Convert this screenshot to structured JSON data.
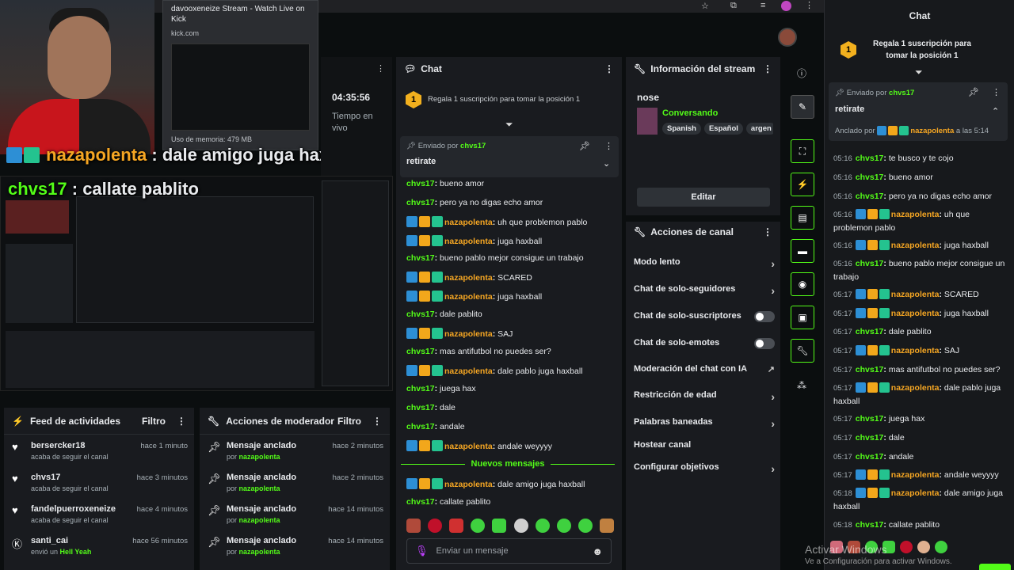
{
  "tab_preview": {
    "title": "davooxeneize Stream - Watch Live on Kick",
    "url": "kick.com",
    "memory": "Uso de memoria: 479 MB"
  },
  "overlay_chat": [
    {
      "user": "nazapolenta",
      "sep": " : ",
      "text": "dale amigo juga haxball"
    },
    {
      "user": "chvs17",
      "sep": " : ",
      "text": "callate pablito"
    }
  ],
  "stats": {
    "time": "04:35:56",
    "label": "Tiempo en vivo"
  },
  "feed": {
    "title": "Feed de actividades",
    "filter": "Filtro",
    "items": [
      {
        "name": "bersercker18",
        "sub": "acaba de seguir el canal",
        "time": "hace 1 minuto"
      },
      {
        "name": "chvs17",
        "sub": "acaba de seguir el canal",
        "time": "hace 3 minutos"
      },
      {
        "name": "fandelpuerroxeneize",
        "sub": "acaba de seguir el canal",
        "time": "hace 4 minutos"
      },
      {
        "name": "santi_cai",
        "sub": "envió un",
        "sub2": "Hell Yeah",
        "time": "hace 56 minutos"
      }
    ]
  },
  "mod_actions": {
    "title": "Acciones de moderador",
    "filter": "Filtro",
    "items": [
      {
        "name": "Mensaje anclado",
        "by": "por",
        "user": "nazapolenta",
        "time": "hace 2 minutos"
      },
      {
        "name": "Mensaje anclado",
        "by": "por",
        "user": "nazapolenta",
        "time": "hace 2 minutos"
      },
      {
        "name": "Mensaje anclado",
        "by": "por",
        "user": "nazapolenta",
        "time": "hace 14 minutos"
      },
      {
        "name": "Mensaje anclado",
        "by": "por",
        "user": "nazapolenta",
        "time": "hace 14 minutos"
      }
    ]
  },
  "chat": {
    "title": "Chat",
    "gift": "Regala 1 suscripción para tomar la posición 1",
    "pinned": {
      "label": "Enviado por",
      "user": "chvs17",
      "text": "retirate"
    },
    "messages": [
      {
        "user": "chvs17",
        "badges": false,
        "text": "bueno amor"
      },
      {
        "user": "chvs17",
        "badges": false,
        "text": "pero ya no digas echo amor"
      },
      {
        "user": "nazapolenta",
        "badges": true,
        "text": "uh que problemon pablo"
      },
      {
        "user": "nazapolenta",
        "badges": true,
        "text": "juga haxball"
      },
      {
        "user": "chvs17",
        "badges": false,
        "text": "bueno pablo mejor consigue un trabajo"
      },
      {
        "user": "nazapolenta",
        "badges": true,
        "text": "SCARED"
      },
      {
        "user": "nazapolenta",
        "badges": true,
        "text": "juga haxball"
      },
      {
        "user": "chvs17",
        "badges": false,
        "text": "dale pablito"
      },
      {
        "user": "nazapolenta",
        "badges": true,
        "text": "SAJ"
      },
      {
        "user": "chvs17",
        "badges": false,
        "text": "mas antifutbol no puedes ser?"
      },
      {
        "user": "nazapolenta",
        "badges": true,
        "text": "dale pablo juga haxball"
      },
      {
        "user": "chvs17",
        "badges": false,
        "text": "juega hax"
      },
      {
        "user": "chvs17",
        "badges": false,
        "text": "dale"
      },
      {
        "user": "chvs17",
        "badges": false,
        "text": "andale"
      },
      {
        "user": "nazapolenta",
        "badges": true,
        "text": "andale weyyyy"
      }
    ],
    "new_label": "Nuevos mensajes",
    "new_messages": [
      {
        "user": "nazapolenta",
        "badges": true,
        "text": "dale amigo juga haxball"
      },
      {
        "user": "chvs17",
        "badges": false,
        "text": "callate pablito"
      }
    ],
    "input_placeholder": "Enviar un mensaje"
  },
  "info": {
    "title": "Información del stream",
    "stream_title": "nose",
    "category": "Conversando",
    "tags": [
      "Spanish",
      "Español",
      "argen"
    ],
    "edit": "Editar"
  },
  "channel_actions": {
    "title": "Acciones de canal",
    "items": [
      "Modo lento",
      "Chat de solo-seguidores",
      "Chat de solo-suscriptores",
      "Chat de solo-emotes",
      "Moderación del chat con IA",
      "Restricción de edad",
      "Palabras baneadas",
      "Hostear canal",
      "Configurar objetivos"
    ]
  },
  "rchat": {
    "title": "Chat",
    "gift": "Regala 1 suscripción para tomar la posición 1",
    "pinned": {
      "label": "Enviado por",
      "user": "chvs17",
      "text": "retirate",
      "anchored": "Anclado por",
      "anchor_user": "nazapolenta",
      "anchor_time": "a las 5:14"
    },
    "messages": [
      {
        "ts": "05:16",
        "user": "chvs17",
        "badges": false,
        "text": "te busco y te cojo"
      },
      {
        "ts": "05:16",
        "user": "chvs17",
        "badges": false,
        "text": "bueno amor"
      },
      {
        "ts": "05:16",
        "user": "chvs17",
        "badges": false,
        "text": "pero ya no digas echo amor"
      },
      {
        "ts": "05:16",
        "user": "nazapolenta",
        "badges": true,
        "text": "uh que problemon pablo"
      },
      {
        "ts": "05:16",
        "user": "nazapolenta",
        "badges": true,
        "text": "juga haxball"
      },
      {
        "ts": "05:16",
        "user": "chvs17",
        "badges": false,
        "text": "bueno pablo mejor consigue un trabajo"
      },
      {
        "ts": "05:17",
        "user": "nazapolenta",
        "badges": true,
        "text": "SCARED"
      },
      {
        "ts": "05:17",
        "user": "nazapolenta",
        "badges": true,
        "text": "juga haxball"
      },
      {
        "ts": "05:17",
        "user": "chvs17",
        "badges": false,
        "text": "dale pablito"
      },
      {
        "ts": "05:17",
        "user": "nazapolenta",
        "badges": true,
        "text": "SAJ"
      },
      {
        "ts": "05:17",
        "user": "chvs17",
        "badges": false,
        "text": "mas antifutbol no puedes ser?"
      },
      {
        "ts": "05:17",
        "user": "nazapolenta",
        "badges": true,
        "text": "dale pablo juga haxball"
      },
      {
        "ts": "05:17",
        "user": "chvs17",
        "badges": false,
        "text": "juega hax"
      },
      {
        "ts": "05:17",
        "user": "chvs17",
        "badges": false,
        "text": "dale"
      },
      {
        "ts": "05:17",
        "user": "chvs17",
        "badges": false,
        "text": "andale"
      },
      {
        "ts": "05:17",
        "user": "nazapolenta",
        "badges": true,
        "text": "andale weyyyy"
      },
      {
        "ts": "05:18",
        "user": "nazapolenta",
        "badges": true,
        "text": "dale amigo juga haxball"
      },
      {
        "ts": "05:18",
        "user": "chvs17",
        "badges": false,
        "text": "callate pablito"
      }
    ],
    "activate": "Activar Windows",
    "activate_sub": "Ve a Configuración para activar Windows."
  },
  "colors": {
    "kick_green": "#53fc18",
    "orange_user": "#f5a623",
    "panel": "#191b1f"
  }
}
